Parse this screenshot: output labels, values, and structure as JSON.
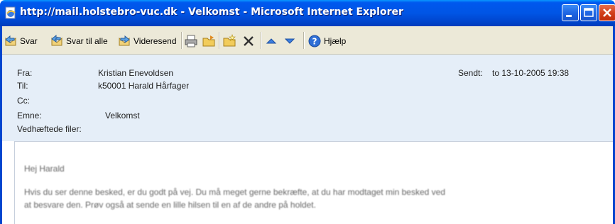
{
  "window": {
    "title": "http://mail.holstebro-vuc.dk - Velkomst - Microsoft Internet Explorer"
  },
  "toolbar": {
    "reply_label": "Svar",
    "reply_all_label": "Svar til alle",
    "forward_label": "Videresend",
    "help_label": "Hjælp",
    "icons": [
      "reply-icon",
      "reply-all-icon",
      "forward-icon",
      "print-icon",
      "move-folder-icon",
      "new-folder-icon",
      "delete-icon",
      "previous-icon",
      "next-icon",
      "help-icon"
    ]
  },
  "header": {
    "from_label": "Fra:",
    "from_value": "Kristian Enevoldsen",
    "to_label": "Til:",
    "to_value": "k50001 Harald Hårfager",
    "cc_label": "Cc:",
    "subject_label": "Emne:",
    "subject_value": "Velkomst",
    "attachments_label": "Vedhæftede filer:",
    "sent_label": "Sendt:",
    "sent_value": "to 13-10-2005 19:38"
  },
  "message": {
    "greeting": "Hej Harald",
    "line1": "Hvis du ser denne besked, er du godt på vej. Du må meget gerne bekræfte, at du har modtaget min besked ved",
    "line2": "at besvare den. Prøv også at sende en lille hilsen til en af de andre på holdet."
  },
  "colors": {
    "titlebar": "#0055e5",
    "toolbar": "#ece9d8",
    "header_bg": "#e5eef8",
    "close_button": "#d2401c"
  }
}
